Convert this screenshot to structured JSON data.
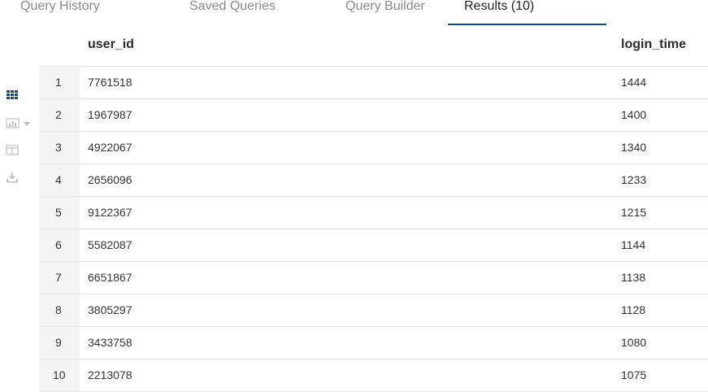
{
  "tabs": [
    {
      "label": "Query History",
      "active": false
    },
    {
      "label": "Saved Queries",
      "active": false
    },
    {
      "label": "Query Builder",
      "active": false
    },
    {
      "label": "Results (10)",
      "active": true
    }
  ],
  "toolbar": {
    "icons": [
      "grid-view-icon",
      "chart-icon",
      "columns-icon",
      "download-icon"
    ],
    "accent_color": "#0b4f7c"
  },
  "results": {
    "columns": [
      "user_id",
      "login_time"
    ],
    "rows": [
      {
        "index": "1",
        "user_id": "7761518",
        "login_time": "1444"
      },
      {
        "index": "2",
        "user_id": "1967987",
        "login_time": "1400"
      },
      {
        "index": "3",
        "user_id": "4922067",
        "login_time": "1340"
      },
      {
        "index": "4",
        "user_id": "2656096",
        "login_time": "1233"
      },
      {
        "index": "5",
        "user_id": "9122367",
        "login_time": "1215"
      },
      {
        "index": "6",
        "user_id": "5582087",
        "login_time": "1144"
      },
      {
        "index": "7",
        "user_id": "6651867",
        "login_time": "1138"
      },
      {
        "index": "8",
        "user_id": "3805297",
        "login_time": "1128"
      },
      {
        "index": "9",
        "user_id": "3433758",
        "login_time": "1080"
      },
      {
        "index": "10",
        "user_id": "2213078",
        "login_time": "1075"
      }
    ]
  }
}
